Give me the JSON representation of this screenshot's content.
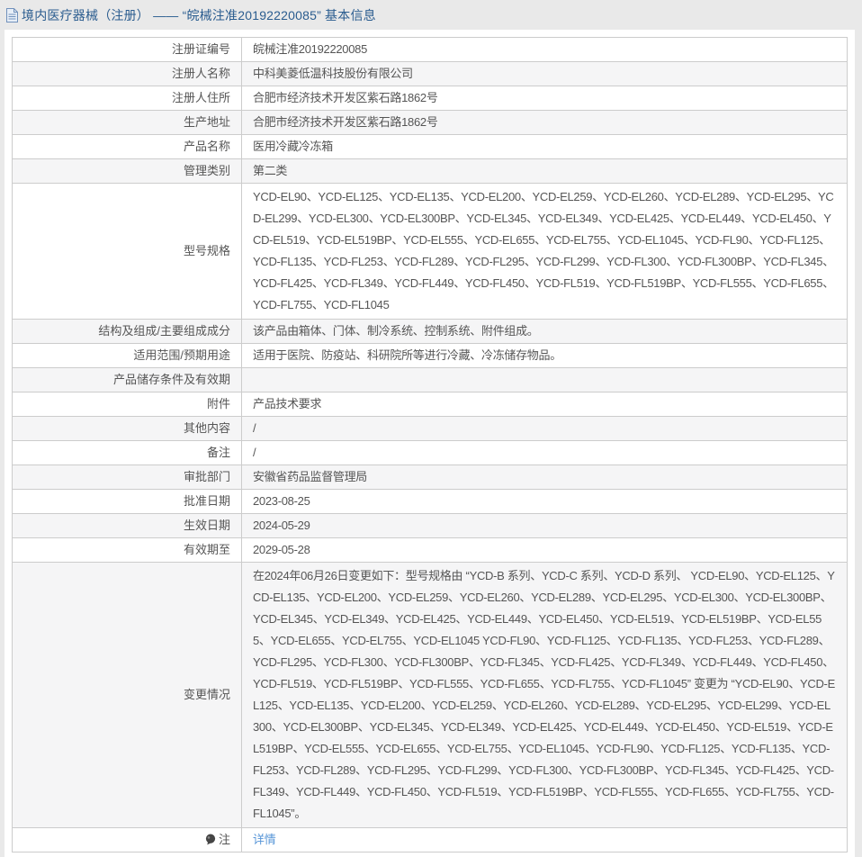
{
  "header": {
    "title": "境内医疗器械（注册） —— “皖械注准20192220085” 基本信息",
    "icon": "document-icon"
  },
  "colors": {
    "title_blue": "#2a5c8f",
    "link_blue": "#5795d7",
    "row_stripe": "#f5f5f6",
    "border": "#cccccc",
    "text": "#555555"
  },
  "table": {
    "rows": [
      {
        "label": "注册证编号",
        "value": "皖械注准20192220085"
      },
      {
        "label": "注册人名称",
        "value": "中科美菱低温科技股份有限公司"
      },
      {
        "label": "注册人住所",
        "value": "合肥市经济技术开发区紫石路1862号"
      },
      {
        "label": "生产地址",
        "value": "合肥市经济技术开发区紫石路1862号"
      },
      {
        "label": "产品名称",
        "value": "医用冷藏冷冻箱"
      },
      {
        "label": "管理类别",
        "value": "第二类"
      },
      {
        "label": "型号规格",
        "value": "YCD-EL90、YCD-EL125、YCD-EL135、YCD-EL200、YCD-EL259、YCD-EL260、YCD-EL289、YCD-EL295、YCD-EL299、YCD-EL300、YCD-EL300BP、YCD-EL345、YCD-EL349、YCD-EL425、YCD-EL449、YCD-EL450、YCD-EL519、YCD-EL519BP、YCD-EL555、YCD-EL655、YCD-EL755、YCD-EL1045、YCD-FL90、YCD-FL125、YCD-FL135、YCD-FL253、YCD-FL289、YCD-FL295、YCD-FL299、YCD-FL300、YCD-FL300BP、YCD-FL345、YCD-FL425、YCD-FL349、YCD-FL449、YCD-FL450、YCD-FL519、YCD-FL519BP、YCD-FL555、YCD-FL655、YCD-FL755、YCD-FL1045"
      },
      {
        "label": "结构及组成/主要组成成分",
        "value": "该产品由箱体、门体、制冷系统、控制系统、附件组成。"
      },
      {
        "label": "适用范围/预期用途",
        "value": "适用于医院、防疫站、科研院所等进行冷藏、冷冻储存物品。"
      },
      {
        "label": "产品储存条件及有效期",
        "value": ""
      },
      {
        "label": "附件",
        "value": "产品技术要求"
      },
      {
        "label": "其他内容",
        "value": "/"
      },
      {
        "label": "备注",
        "value": "/"
      },
      {
        "label": "审批部门",
        "value": "安徽省药品监督管理局"
      },
      {
        "label": "批准日期",
        "value": "2023-08-25"
      },
      {
        "label": "生效日期",
        "value": "2024-05-29"
      },
      {
        "label": "有效期至",
        "value": "2029-05-28"
      },
      {
        "label": "变更情况",
        "value": "在2024年06月26日变更如下：型号规格由 “YCD-B 系列、YCD-C 系列、YCD-D 系列、 YCD-EL90、YCD-EL125、YCD-EL135、YCD-EL200、YCD-EL259、YCD-EL260、YCD-EL289、YCD-EL295、YCD-EL300、YCD-EL300BP、YCD-EL345、YCD-EL349、YCD-EL425、YCD-EL449、YCD-EL450、YCD-EL519、YCD-EL519BP、YCD-EL555、YCD-EL655、YCD-EL755、YCD-EL1045 YCD-FL90、YCD-FL125、YCD-FL135、YCD-FL253、YCD-FL289、YCD-FL295、YCD-FL300、YCD-FL300BP、YCD-FL345、YCD-FL425、YCD-FL349、YCD-FL449、YCD-FL450、YCD-FL519、YCD-FL519BP、YCD-FL555、YCD-FL655、YCD-FL755、YCD-FL1045” 变更为 “YCD-EL90、YCD-EL125、YCD-EL135、YCD-EL200、YCD-EL259、YCD-EL260、YCD-EL289、YCD-EL295、YCD-EL299、YCD-EL300、YCD-EL300BP、YCD-EL345、YCD-EL349、YCD-EL425、YCD-EL449、YCD-EL450、YCD-EL519、YCD-EL519BP、YCD-EL555、YCD-EL655、YCD-EL755、YCD-EL1045、YCD-FL90、YCD-FL125、YCD-FL135、YCD-FL253、YCD-FL289、YCD-FL295、YCD-FL299、YCD-FL300、YCD-FL300BP、YCD-FL345、YCD-FL425、YCD-FL349、YCD-FL449、YCD-FL450、YCD-FL519、YCD-FL519BP、YCD-FL555、YCD-FL655、YCD-FL755、YCD-FL1045”。"
      },
      {
        "label": "注",
        "icon": "note-balloon-icon",
        "link": "详情"
      }
    ]
  }
}
